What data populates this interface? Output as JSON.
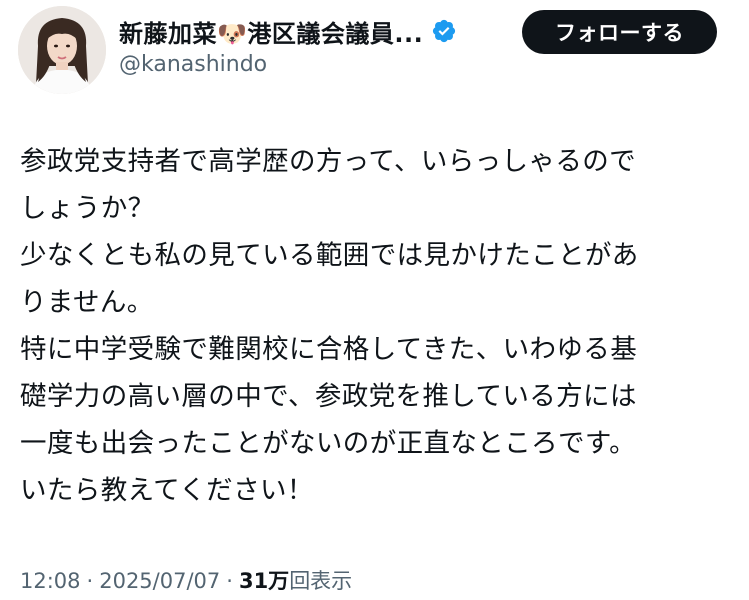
{
  "profile": {
    "display_name": "新藤加菜🐶港区議会議員...",
    "name_text": "新藤加菜",
    "name_suffix": "港区議会議員...",
    "emoji": "🐶",
    "verified_icon": "verified-badge-icon",
    "handle": "@kanashindo",
    "follow_label": "フォローする"
  },
  "tweet": {
    "lines": [
      "参政党支持者で高学歴の方って、いらっしゃるので",
      "しょうか？",
      "少なくとも私の見ている範囲では見かけたことがあ",
      "りません。",
      "特に中学受験で難関校に合格してきた、いわゆる基",
      "礎学力の高い層の中で、参政党を推している方には",
      "一度も出会ったことがないのが正直なところです。",
      "いたら教えてください！"
    ]
  },
  "meta": {
    "time": "12:08",
    "separator": "·",
    "date": "2025/07/07",
    "views_count": "31万",
    "views_label": "回表示"
  },
  "colors": {
    "text_primary": "#0f1419",
    "text_secondary": "#536471",
    "verified_blue": "#1d9bf0",
    "button_bg": "#0f1419",
    "button_text": "#ffffff"
  }
}
